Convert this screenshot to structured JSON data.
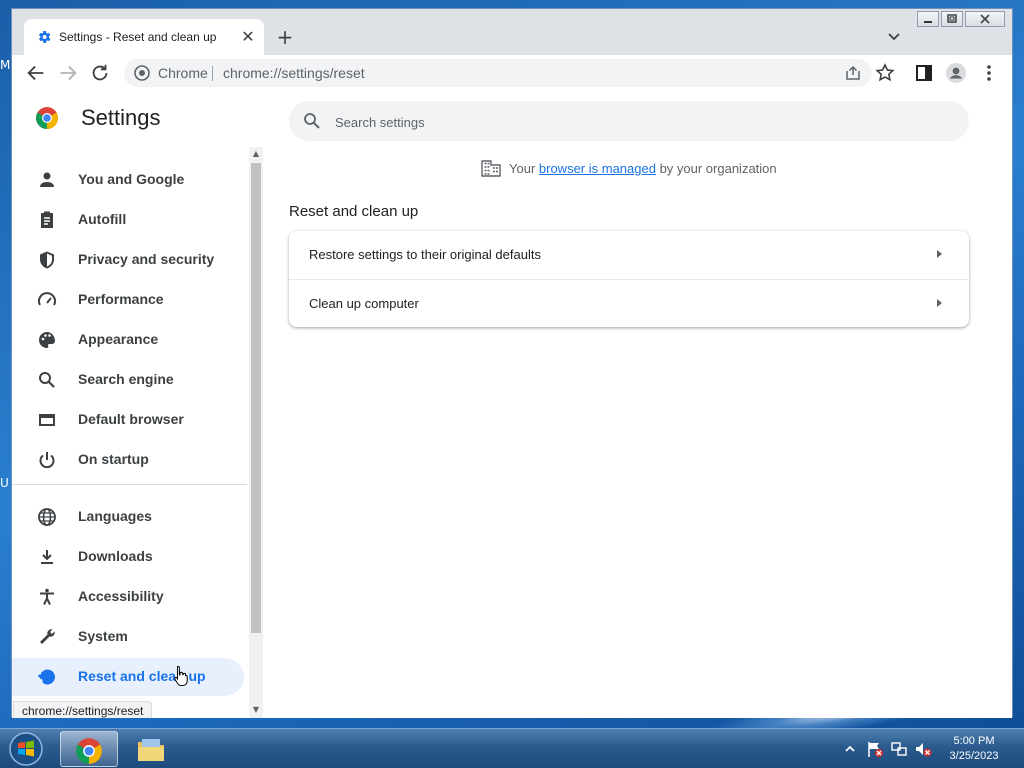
{
  "window": {
    "tab_title": "Settings - Reset and clean up",
    "omnibox_chip": "Chrome",
    "url": "chrome://settings/reset"
  },
  "settings": {
    "title": "Settings",
    "search_placeholder": "Search settings",
    "managed_prefix": "Your ",
    "managed_link": "browser is managed",
    "managed_suffix": " by your organization",
    "section_title": "Reset and clean up",
    "rows": [
      {
        "label": "Restore settings to their original defaults"
      },
      {
        "label": "Clean up computer"
      }
    ]
  },
  "sidebar": {
    "items": [
      {
        "label": "You and Google",
        "icon": "person-icon"
      },
      {
        "label": "Autofill",
        "icon": "clipboard-icon"
      },
      {
        "label": "Privacy and security",
        "icon": "shield-icon"
      },
      {
        "label": "Performance",
        "icon": "speedometer-icon"
      },
      {
        "label": "Appearance",
        "icon": "palette-icon"
      },
      {
        "label": "Search engine",
        "icon": "search-icon"
      },
      {
        "label": "Default browser",
        "icon": "browser-window-icon"
      },
      {
        "label": "On startup",
        "icon": "power-icon"
      },
      {
        "label": "Languages",
        "icon": "globe-icon"
      },
      {
        "label": "Downloads",
        "icon": "download-icon"
      },
      {
        "label": "Accessibility",
        "icon": "accessibility-icon"
      },
      {
        "label": "System",
        "icon": "wrench-icon"
      },
      {
        "label": "Reset and clean up",
        "icon": "history-restore-icon",
        "active": true
      }
    ]
  },
  "status_bar": {
    "link_preview": "chrome://settings/reset"
  },
  "taskbar": {
    "time": "5:00 PM",
    "date": "3/25/2023"
  },
  "desktop": {
    "edge_letters": [
      "M",
      "U"
    ]
  },
  "colors": {
    "accent": "#1a73e8",
    "active_nav_bg": "#e8f0fe"
  }
}
